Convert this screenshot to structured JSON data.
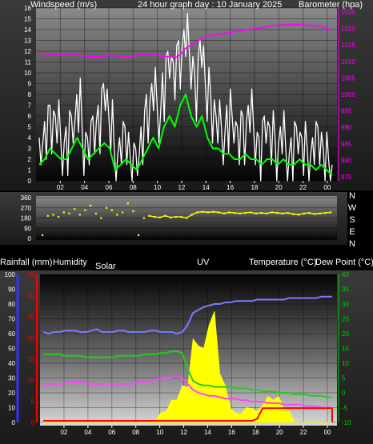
{
  "header": {
    "windspeed_label": "Windspeed (m/s)",
    "graph_title": "24 hour graph day : 10 January 2025",
    "barometer_label": "Barometer (hpa)"
  },
  "colors": {
    "windspeed": "#ffffff",
    "wind_avg": "#00ff00",
    "barometer": "#ff00ff",
    "wind_dir": "#ffff00",
    "humidity": "#7b7bff",
    "temperature": "#ff44ff",
    "dewpoint": "#22cc22",
    "solar": "#ffff00",
    "rain": "#ff0000",
    "left_axis_blue": "#3333ff",
    "rain_axis_red": "#ff0000",
    "temp_axis_green": "#00cc00",
    "grid_dark": "#111111",
    "grid_light": "#b0b0b0"
  },
  "chart_data": [
    {
      "type": "line",
      "name": "wind-barometer",
      "xlabel": "",
      "x_ticks": [
        "02",
        "04",
        "06",
        "08",
        "10",
        "12",
        "14",
        "16",
        "18",
        "20",
        "22",
        "00"
      ],
      "y_left_label": "Windspeed (m/s)",
      "y_left_ticks": [
        0,
        1,
        2,
        3,
        4,
        5,
        6,
        7,
        8,
        9,
        10,
        11,
        12,
        13,
        14,
        15,
        16
      ],
      "ylim_left": [
        0,
        16
      ],
      "y_right_label": "Barometer (hpa)",
      "y_right_ticks": [
        975,
        980,
        985,
        990,
        995,
        1000,
        1005,
        1010,
        1015,
        1020,
        1025
      ],
      "ylim_right": [
        975,
        1025
      ],
      "series": [
        {
          "axis": "left",
          "style": "gust",
          "values": [
            4,
            5.5,
            7,
            6,
            4,
            5,
            6,
            8,
            5,
            4,
            6,
            7,
            9,
            6,
            3,
            4,
            5,
            2,
            3,
            5,
            8,
            9,
            7,
            10,
            12,
            11,
            13,
            14,
            12,
            10,
            13,
            9,
            8,
            6,
            5,
            7,
            6,
            5,
            6,
            7,
            5,
            4,
            6,
            5,
            4,
            5,
            3,
            4,
            5,
            4,
            3,
            4,
            5,
            3,
            2
          ]
        },
        {
          "axis": "left",
          "style": "avg",
          "values": [
            1.5,
            2,
            3,
            2.5,
            2,
            2,
            3,
            4,
            3,
            2,
            2.5,
            3,
            3.5,
            3,
            1,
            1.5,
            2,
            1.5,
            1,
            2,
            3,
            4,
            3,
            5,
            6,
            5,
            7,
            8,
            6,
            5,
            6,
            4,
            3,
            3,
            2.5,
            2.5,
            2,
            2,
            2.5,
            2,
            2,
            1.5,
            2,
            2,
            1.5,
            2,
            1.5,
            1.5,
            2,
            1.5,
            1.5,
            1,
            1.5,
            1,
            0.5
          ]
        },
        {
          "axis": "right",
          "style": "barometer",
          "values": [
            1012.5,
            1012.3,
            1012,
            1012,
            1012,
            1011.8,
            1012,
            1012,
            1011.8,
            1011.5,
            1011.5,
            1011.5,
            1011.5,
            1012,
            1011.8,
            1011.5,
            1011.3,
            1011.5,
            1012,
            1012,
            1012,
            1012,
            1011.8,
            1011.5,
            1011.5,
            1011,
            1012,
            1014,
            1015,
            1016,
            1017,
            1017.5,
            1018,
            1018.3,
            1018.5,
            1018.8,
            1019,
            1019.3,
            1019.5,
            1019.7,
            1020,
            1020.3,
            1020.5,
            1020.8,
            1021,
            1021,
            1021.2,
            1021.2,
            1021.2,
            1021,
            1021,
            1020.8,
            1020.5,
            1020,
            1019.5
          ]
        }
      ]
    },
    {
      "type": "scatter",
      "name": "wind-direction",
      "y_ticks": [
        0,
        90,
        180,
        270,
        360
      ],
      "ylim": [
        0,
        360
      ],
      "compass_labels": [
        "N",
        "W",
        "S",
        "E",
        "N"
      ],
      "values": [
        30,
        200,
        210,
        190,
        230,
        220,
        260,
        210,
        250,
        290,
        220,
        180,
        270,
        250,
        210,
        230,
        310,
        240,
        30,
        180,
        200,
        190,
        185,
        200,
        185,
        190,
        190,
        180,
        210,
        230,
        235,
        230,
        235,
        230,
        220,
        230,
        225,
        220,
        225,
        230,
        220,
        225,
        220,
        230,
        225,
        220,
        225,
        215,
        210,
        220,
        225,
        215,
        220,
        225,
        230
      ]
    },
    {
      "type": "line",
      "name": "climate",
      "labels": {
        "rainfall": "Rainfall (mm)",
        "humidity": "Humidity",
        "solar": "Solar",
        "uv": "UV",
        "temperature": "Temperature (°C)",
        "dewpoint": "Dew Point (°C)"
      },
      "x_ticks": [
        "02",
        "04",
        "06",
        "08",
        "10",
        "12",
        "14",
        "16",
        "18",
        "20",
        "22",
        "00"
      ],
      "y_humidity_ticks": [
        0,
        10,
        20,
        30,
        40,
        50,
        60,
        70,
        80,
        90,
        100
      ],
      "ylim_humidity": [
        0,
        100
      ],
      "y_rain_ticks": [
        0,
        5,
        10,
        15,
        20,
        25,
        30,
        35
      ],
      "ylim_rain": [
        0,
        35
      ],
      "y_temp_ticks": [
        -10,
        -5,
        0,
        5,
        10,
        15,
        20,
        25,
        30,
        35,
        40
      ],
      "ylim_temp": [
        -10,
        40
      ],
      "series": [
        {
          "axis": "humidity",
          "style": "humidity",
          "values": [
            61,
            60,
            61,
            61,
            62,
            62,
            62,
            61,
            61,
            62,
            63,
            61,
            61,
            61,
            62,
            62,
            61,
            61,
            61,
            61,
            62,
            62,
            61,
            61,
            61,
            60,
            61,
            66,
            74,
            76,
            78,
            79,
            80,
            80,
            81,
            81,
            82,
            82,
            82,
            82,
            83,
            83,
            83,
            83,
            83,
            83,
            84,
            84,
            84,
            84,
            84,
            84,
            85,
            85,
            85
          ]
        },
        {
          "axis": "temp",
          "style": "temperature",
          "values": [
            3,
            3,
            3,
            3,
            3.2,
            3.5,
            3.5,
            3.5,
            3.2,
            3,
            3,
            3,
            3,
            3,
            3,
            3,
            3,
            3.2,
            3.5,
            3.5,
            4,
            4.5,
            4.8,
            5,
            5.2,
            5.5,
            5,
            3,
            1,
            0,
            -0.5,
            -1,
            -1,
            -1.5,
            -2,
            -2,
            -2,
            -2.5,
            -2.5,
            -3,
            -3,
            -3,
            -3.5,
            -3.5,
            -3.5,
            -4,
            -4,
            -4,
            -4,
            -4.5,
            -4.5,
            -4.5,
            -5,
            -5,
            -5
          ]
        },
        {
          "axis": "temp",
          "style": "dewpoint",
          "values": [
            13,
            13,
            13,
            13,
            12.5,
            12.5,
            12.5,
            12.5,
            12,
            12,
            12,
            12,
            12,
            12,
            12.5,
            12.5,
            12.5,
            12.5,
            12.5,
            13,
            13,
            13,
            13.5,
            13.5,
            14,
            14,
            13.5,
            8,
            4,
            3,
            2.5,
            2.5,
            2,
            2,
            2,
            2,
            1.5,
            1.5,
            1.5,
            1,
            1,
            0.5,
            0.5,
            0.5,
            0,
            0,
            0,
            -0.5,
            -0.5,
            -0.5,
            -1,
            -1,
            -1,
            -1.5,
            -1.5
          ]
        },
        {
          "axis": "solar",
          "style": "solar",
          "values": [
            0,
            0,
            0,
            0,
            0,
            0,
            0,
            0,
            0,
            0,
            0,
            0,
            0,
            0,
            0,
            0,
            0,
            0,
            0,
            0,
            0,
            2,
            5,
            8,
            12,
            16,
            20,
            25,
            45,
            55,
            40,
            70,
            60,
            35,
            20,
            10,
            5,
            6,
            8,
            10,
            6,
            12,
            14,
            16,
            14,
            10,
            6,
            0,
            0,
            0,
            0,
            0,
            0,
            0,
            0
          ]
        },
        {
          "axis": "rain",
          "style": "rain",
          "values": [
            0,
            0,
            0,
            0,
            0,
            0,
            0,
            0,
            0,
            0,
            0,
            0,
            0,
            0,
            0,
            0,
            0,
            0,
            0,
            0,
            0,
            0,
            0,
            0,
            0,
            0,
            0,
            0,
            0,
            0,
            0,
            0,
            0,
            0,
            0,
            0,
            0,
            0,
            0,
            0,
            0.5,
            3,
            3,
            3,
            3,
            3,
            3,
            3,
            3,
            3,
            3,
            3,
            3,
            3,
            3
          ]
        }
      ]
    }
  ]
}
